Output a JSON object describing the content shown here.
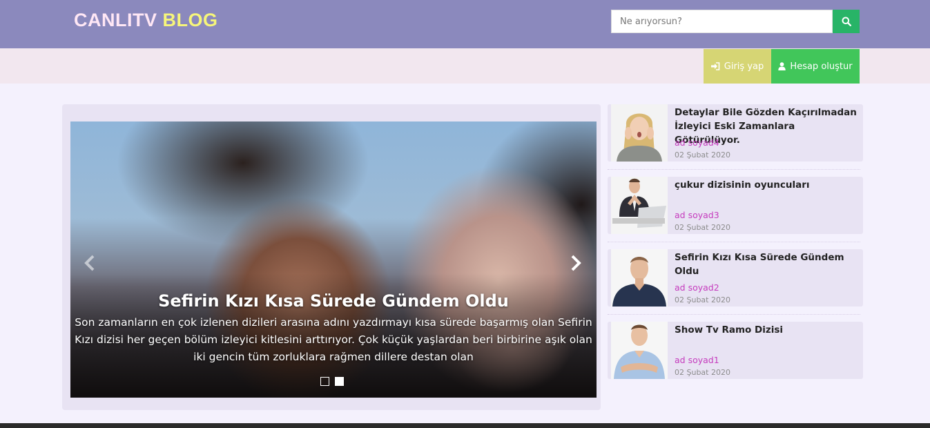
{
  "header": {
    "logo_part1": "CANLITV",
    "logo_part2": "BLOG",
    "search_placeholder": "Ne arıyorsun?"
  },
  "auth": {
    "login_label": "Giriş yap",
    "register_label": "Hesap oluştur"
  },
  "slider": {
    "title": "Sefirin Kızı Kısa Sürede Gündem Oldu",
    "text": "Son zamanların en çok izlenen dizileri arasına adını yazdırmayı kısa sürede başarmış olan Sefirin Kızı dizisi her geçen bölüm izleyici kitlesini arttırıyor. Çok küçük yaşlardan beri birbirine aşık olan iki gencin tüm zorluklara rağmen dillere destan olan"
  },
  "posts": [
    {
      "title": "Detaylar Bile Gözden Kaçırılmadan İzleyici Eski Zamanlara Götürülüyor.",
      "author": "ad soyad4",
      "date": "02 Şubat 2020"
    },
    {
      "title": "çukur dizisinin oyuncuları",
      "author": "ad soyad3",
      "date": "02 Şubat 2020"
    },
    {
      "title": "Sefirin Kızı Kısa Sürede Gündem Oldu",
      "author": "ad soyad2",
      "date": "02 Şubat 2020"
    },
    {
      "title": "Show Tv Ramo Dizisi",
      "author": "ad soyad1",
      "date": "02 Şubat 2020"
    }
  ],
  "colors": {
    "header_bg": "#8b89bd",
    "login_bg": "#d6d574",
    "register_bg": "#41c65a",
    "search_btn_bg": "#28b467",
    "author_color": "#c53bbd"
  },
  "icons": {
    "search": "search-icon",
    "login": "sign-in-icon",
    "register": "user-icon",
    "prev": "chevron-left-icon",
    "next": "chevron-right-icon"
  }
}
